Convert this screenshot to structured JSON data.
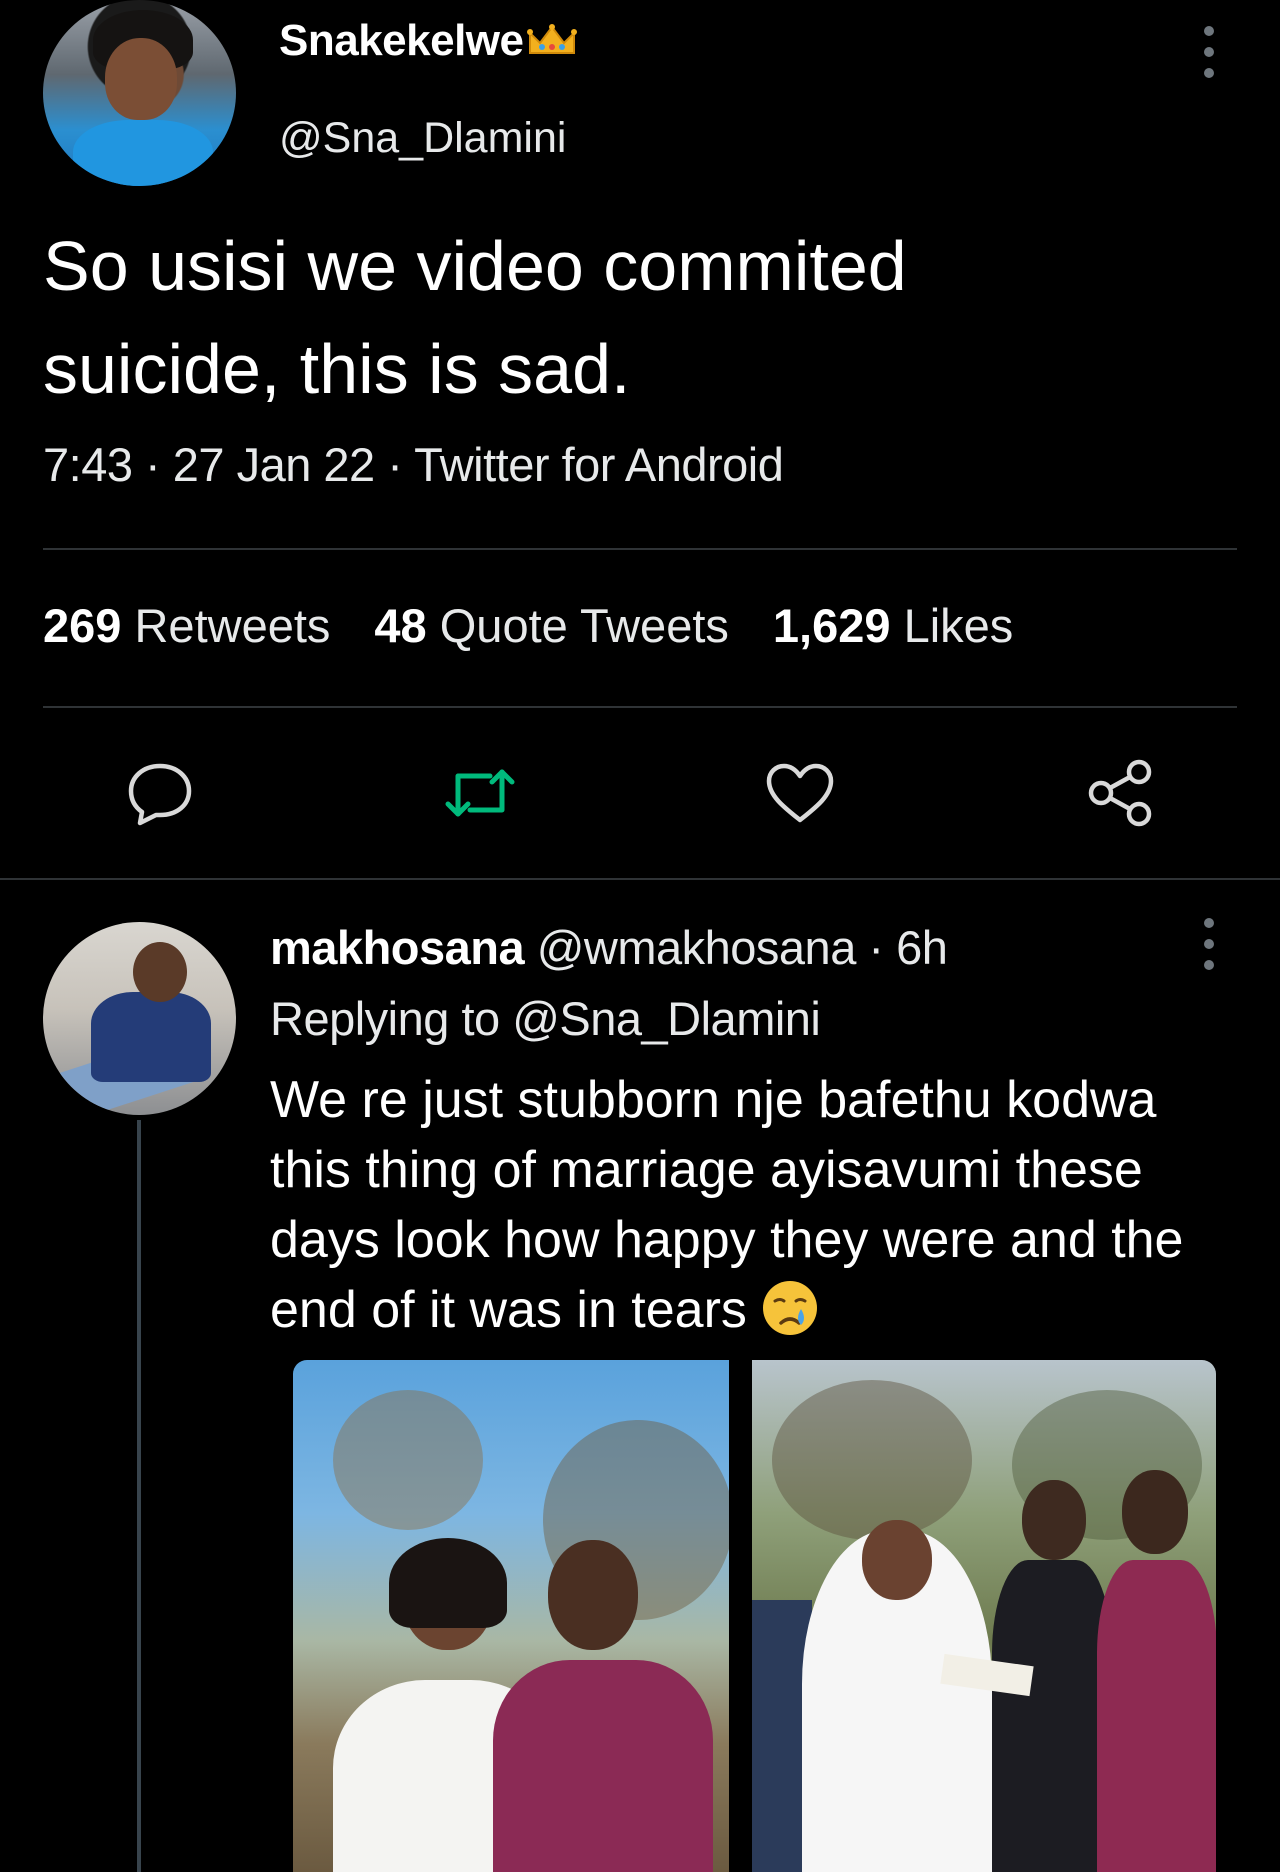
{
  "main_tweet": {
    "author": {
      "display_name": "Snakekelwe",
      "handle": "@Sna_Dlamini"
    },
    "text_line1": "So usisi we video commited",
    "text_line2": "suicide, this is sad.",
    "meta": "7:43 · 27 Jan 22 · Twitter for Android",
    "stats": {
      "retweets_count": "269",
      "retweets_label": "Retweets",
      "quotes_count": "48",
      "quotes_label": "Quote Tweets",
      "likes_count": "1,629",
      "likes_label": "Likes"
    }
  },
  "reply": {
    "display_name": "makhosana",
    "handle_time": "@wmakhosana · 6h",
    "replying_to": "Replying to @Sna_Dlamini",
    "text": "We re just stubborn nje bafethu kodwa this thing of marriage ayisavumi these days look how happy they were and the end of it was in tears"
  },
  "colors": {
    "background": "#000000",
    "text_primary": "#ffffff",
    "text_secondary": "#e7e9ea",
    "divider": "#2f3336",
    "icon_gray": "#d9d9d9",
    "retweet_green": "#00ba7c"
  },
  "icons": {
    "crown": "crown-emoji",
    "more": "more-vertical-icon",
    "reply": "reply-icon",
    "retweet": "retweet-icon",
    "like": "heart-icon",
    "share": "share-icon",
    "crying_face": "crying-face-emoji"
  }
}
